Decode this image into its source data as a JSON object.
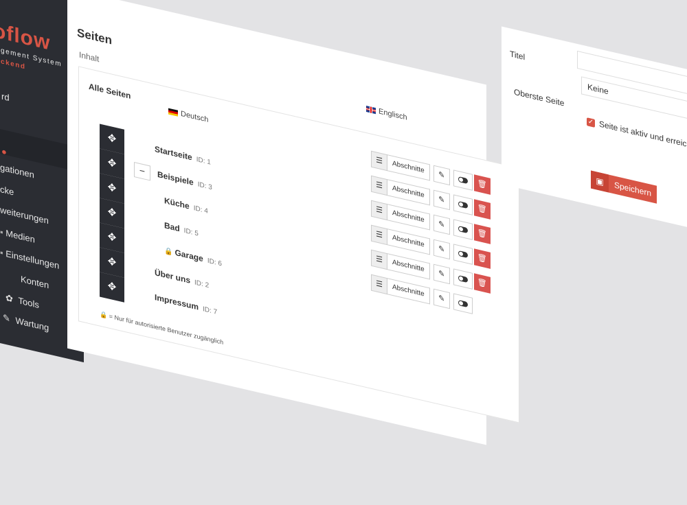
{
  "app": {
    "logo_text": "oflow",
    "subtitle": "agement System",
    "subtitle2": "ackend"
  },
  "sidebar": {
    "items": [
      {
        "label": "rd",
        "icon": "dashboard-icon"
      },
      {
        "label": "",
        "icon": "chevron-down-icon"
      },
      {
        "label": "gationen",
        "icon": "navigation-icon"
      },
      {
        "label": "cke",
        "icon": "blocks-icon"
      },
      {
        "label": "weiterungen",
        "icon": "extensions-icon"
      },
      {
        "label": "Medien",
        "icon": "media-icon"
      },
      {
        "label": "Einstellungen",
        "icon": "settings-icon"
      },
      {
        "label": "Konten",
        "icon": "accounts-icon"
      },
      {
        "label": "Tools",
        "icon": "tools-icon"
      },
      {
        "label": "Wartung",
        "icon": "wrench-icon"
      }
    ],
    "accent": "#d85545"
  },
  "main": {
    "title": "Seiten",
    "subtitle": "Inhalt",
    "all_pages_label": "Alle Seiten",
    "lang_de": "Deutsch",
    "lang_en": "Englisch",
    "sections_label": "Abschnitte",
    "rows": [
      {
        "title": "Startseite",
        "id": "ID: 1",
        "level": 0,
        "locked": false,
        "collapsible": false
      },
      {
        "title": "Beispiele",
        "id": "ID: 3",
        "level": 0,
        "locked": false,
        "collapsible": true
      },
      {
        "title": "Küche",
        "id": "ID: 4",
        "level": 1,
        "locked": false,
        "collapsible": false
      },
      {
        "title": "Bad",
        "id": "ID: 5",
        "level": 1,
        "locked": false,
        "collapsible": false
      },
      {
        "title": "Garage",
        "id": "ID: 6",
        "level": 1,
        "locked": true,
        "collapsible": false
      },
      {
        "title": "Über uns",
        "id": "ID: 2",
        "level": 0,
        "locked": false,
        "collapsible": false
      },
      {
        "title": "Impressum",
        "id": "ID: 7",
        "level": 0,
        "locked": false,
        "collapsible": false
      }
    ],
    "footnote": "= Nur für autorisierte Benutzer zugänglich"
  },
  "form": {
    "title_label": "Titel",
    "title_value": "",
    "parent_label": "Oberste Seite",
    "parent_value": "Keine",
    "active_label": "Seite ist aktiv und erreichbar",
    "active_checked": true,
    "save_label": "Speichern"
  },
  "colors": {
    "accent": "#d85545",
    "dark": "#2b2d33",
    "delete": "#d9534f"
  }
}
